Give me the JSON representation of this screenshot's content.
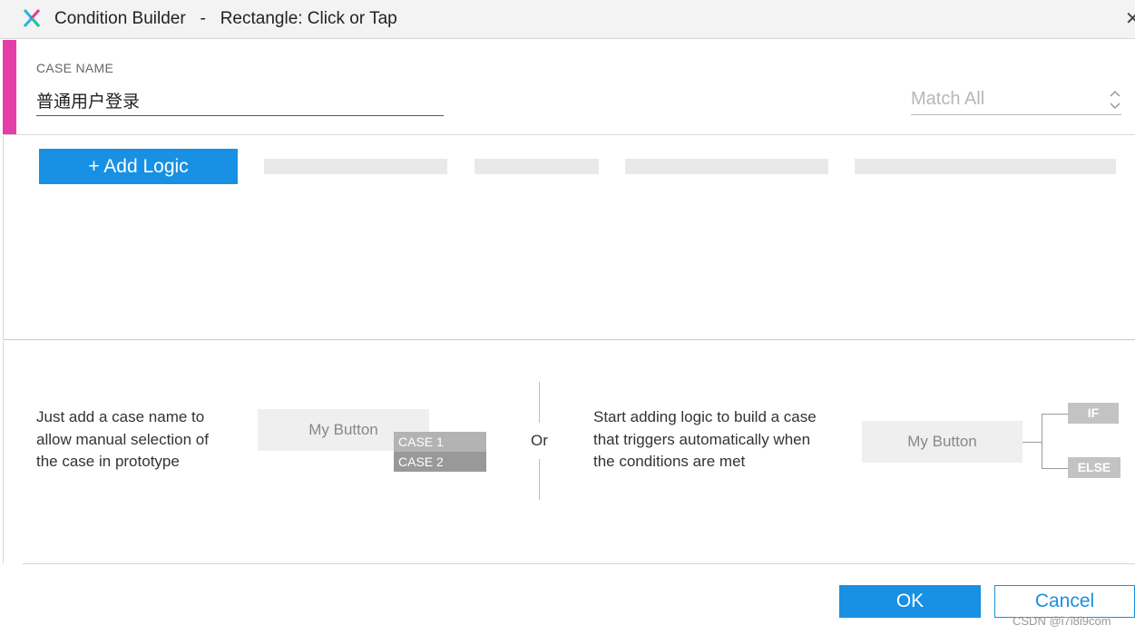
{
  "window": {
    "title": "Condition Builder   -   Rectangle: Click or Tap",
    "logo_icon": "axure-x-logo",
    "close_icon": "close-icon"
  },
  "case": {
    "label": "CASE NAME",
    "name_value": "普通用户登录",
    "accent_color": "#e33fa6",
    "match_mode": "Match All"
  },
  "logic": {
    "add_label": "+ Add Logic"
  },
  "help": {
    "left_text": [
      "Just add a case name to",
      "allow manual selection of",
      "the case in prototype"
    ],
    "left_button": "My Button",
    "case_tags": [
      "CASE 1",
      "CASE 2"
    ],
    "or_label": "Or",
    "right_text": [
      "Start adding logic to build a case",
      "that triggers automatically when",
      "the conditions are met"
    ],
    "right_button": "My Button",
    "if_label": "IF",
    "else_label": "ELSE"
  },
  "footer": {
    "ok_label": "OK",
    "cancel_label": "Cancel",
    "watermark": "CSDN @i7i8i9com"
  },
  "colors": {
    "primary": "#1890e3",
    "accent": "#e33fa6"
  }
}
